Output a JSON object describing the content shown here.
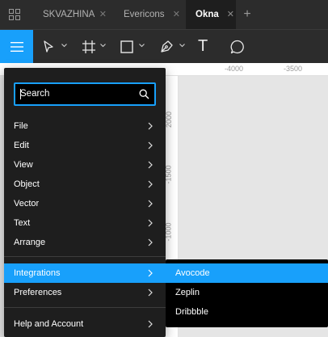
{
  "tabs": [
    {
      "label": "SKVAZHINA",
      "active": false
    },
    {
      "label": "Evericons",
      "active": false
    },
    {
      "label": "Okna",
      "active": true
    }
  ],
  "tab_close_glyph": "✕",
  "tab_add_glyph": "+",
  "toolbar": {
    "tools": [
      "menu-icon",
      "move-tool-icon",
      "frame-tool-icon",
      "rectangle-tool-icon",
      "pen-tool-icon",
      "text-tool-icon",
      "comment-tool-icon"
    ],
    "text_tool_glyph": "T"
  },
  "ruler": {
    "top_ticks": [
      "-4000",
      "-3500"
    ],
    "left_ticks": [
      "2000",
      "-1500",
      "-1000"
    ]
  },
  "menu": {
    "search": {
      "value": "Search",
      "placeholder": "Search"
    },
    "items": [
      {
        "label": "File"
      },
      {
        "label": "Edit"
      },
      {
        "label": "View"
      },
      {
        "label": "Object"
      },
      {
        "label": "Vector"
      },
      {
        "label": "Text"
      },
      {
        "label": "Arrange"
      },
      {
        "label": "Integrations"
      },
      {
        "label": "Preferences"
      },
      {
        "label": "Help and Account"
      }
    ]
  },
  "submenu": {
    "items": [
      {
        "label": "Avocode"
      },
      {
        "label": "Zeplin"
      },
      {
        "label": "Dribbble"
      }
    ]
  },
  "colors": {
    "accent": "#18a0fb",
    "toolbar_bg": "#2c2c2c",
    "menu_bg": "#1e1e1e",
    "canvas_bg": "#e5e5e5"
  }
}
